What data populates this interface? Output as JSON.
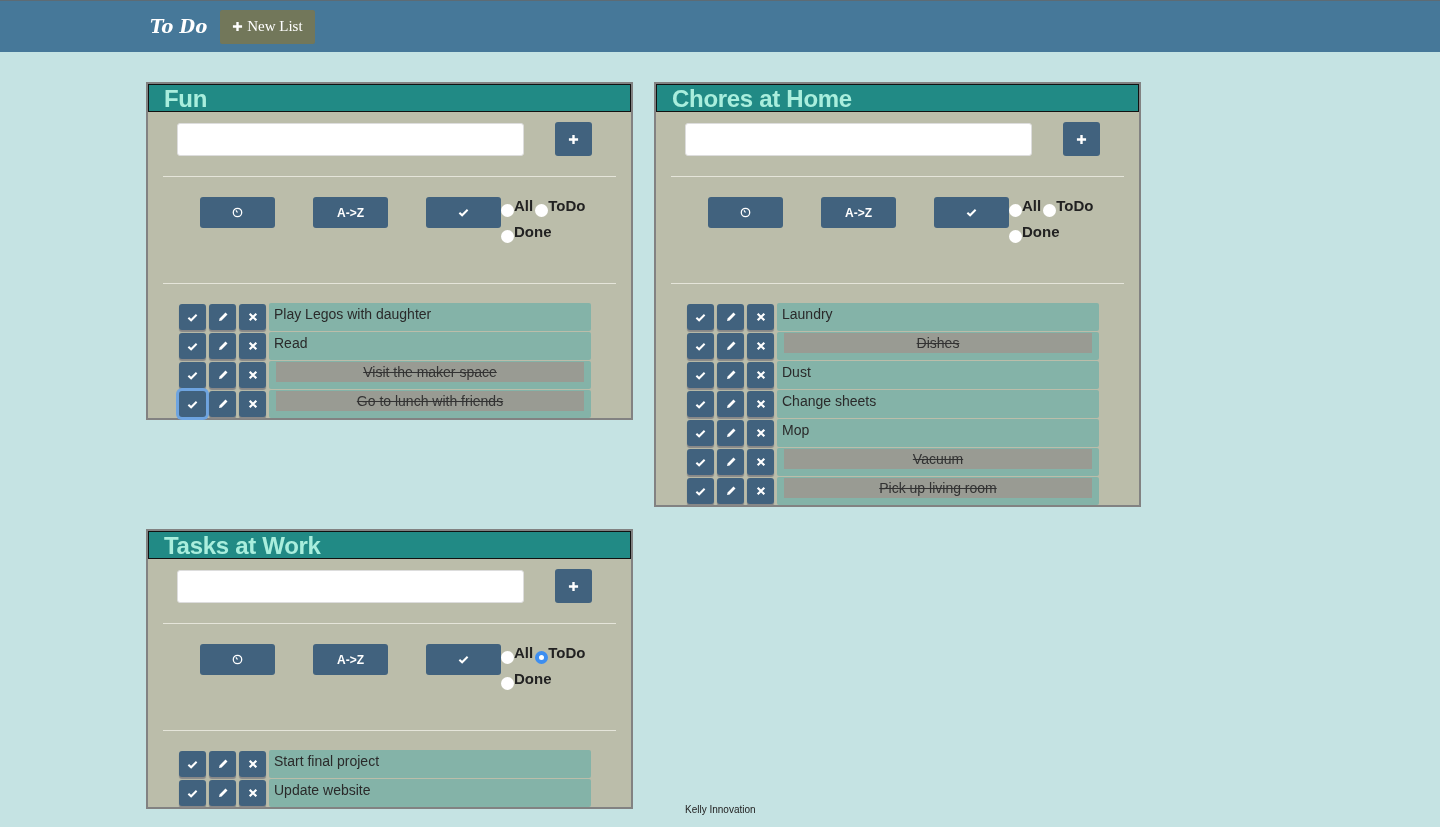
{
  "header": {
    "brand": "To Do",
    "new_list_button": "New List"
  },
  "lists": [
    {
      "title": "Fun",
      "sort_label": "A->Z",
      "filters": [
        {
          "label": "All",
          "selected": false
        },
        {
          "label": "ToDo",
          "selected": false
        },
        {
          "label": "Done",
          "selected": false
        }
      ],
      "items": [
        {
          "text": "Play Legos with daughter",
          "done": false,
          "focused": false
        },
        {
          "text": "Read",
          "done": false,
          "focused": false
        },
        {
          "text": "Visit the maker space",
          "done": true,
          "focused": false
        },
        {
          "text": "Go to lunch with friends",
          "done": true,
          "focused": true
        }
      ]
    },
    {
      "title": "Chores at Home",
      "sort_label": "A->Z",
      "filters": [
        {
          "label": "All",
          "selected": false
        },
        {
          "label": "ToDo",
          "selected": false
        },
        {
          "label": "Done",
          "selected": false
        }
      ],
      "items": [
        {
          "text": "Laundry",
          "done": false,
          "focused": false
        },
        {
          "text": "Dishes",
          "done": true,
          "focused": false
        },
        {
          "text": "Dust",
          "done": false,
          "focused": false
        },
        {
          "text": "Change sheets",
          "done": false,
          "focused": false
        },
        {
          "text": "Mop",
          "done": false,
          "focused": false
        },
        {
          "text": "Vacuum",
          "done": true,
          "focused": false
        },
        {
          "text": "Pick up living room",
          "done": true,
          "focused": false
        }
      ]
    },
    {
      "title": "Tasks at Work",
      "sort_label": "A->Z",
      "filters": [
        {
          "label": "All",
          "selected": false
        },
        {
          "label": "ToDo",
          "selected": true
        },
        {
          "label": "Done",
          "selected": false
        }
      ],
      "items": [
        {
          "text": "Start final project",
          "done": false,
          "focused": false
        },
        {
          "text": "Update website",
          "done": false,
          "focused": false
        }
      ]
    }
  ],
  "footer": "Kelly Innovation"
}
